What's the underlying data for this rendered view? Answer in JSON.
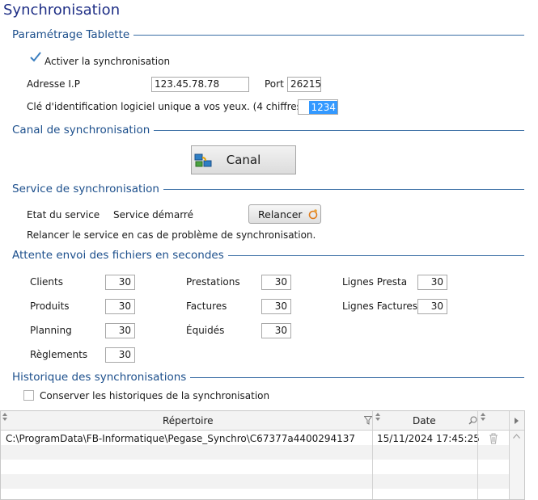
{
  "title": "Synchronisation",
  "sections": {
    "tablette": "Paramétrage Tablette",
    "canal": "Canal de synchronisation",
    "service": "Service de synchronisation",
    "attente": "Attente envoi des fichiers en secondes",
    "historique": "Historique des synchronisations"
  },
  "tablette": {
    "activer_label": "Activer la synchronisation",
    "adresse_label": "Adresse I.P",
    "adresse_value": "123.45.78.78",
    "port_label": "Port",
    "port_value": "26215",
    "cle_label": "Clé d'identification logiciel unique a vos yeux. (4 chiffres)",
    "cle_value": "1234"
  },
  "canal": {
    "button_label": "Canal"
  },
  "service": {
    "etat_label": "Etat du service",
    "etat_value": "Service démarré",
    "relancer_label": "Relancer",
    "hint": "Relancer le service en cas de problème de synchronisation."
  },
  "attente": {
    "clients": {
      "label": "Clients",
      "value": "30"
    },
    "produits": {
      "label": "Produits",
      "value": "30"
    },
    "planning": {
      "label": "Planning",
      "value": "30"
    },
    "reglements": {
      "label": "Règlements",
      "value": "30"
    },
    "prestations": {
      "label": "Prestations",
      "value": "30"
    },
    "factures": {
      "label": "Factures",
      "value": "30"
    },
    "equides": {
      "label": "Équidés",
      "value": "30"
    },
    "lignes_presta": {
      "label": "Lignes Presta",
      "value": "30"
    },
    "lignes_factures": {
      "label": "Lignes Factures",
      "value": "30"
    }
  },
  "historique": {
    "conserver_label": "Conserver les historiques de la synchronisation",
    "columns": {
      "repertoire": "Répertoire",
      "date": "Date"
    },
    "rows": [
      {
        "repertoire": "C:\\ProgramData\\FB-Informatique\\Pegase_Synchro\\C67377a4400294137",
        "date": "15/11/2024 17:45:25"
      }
    ]
  },
  "colors": {
    "title": "#1f2f86",
    "section": "#1c4f8c",
    "selection": "#3399ff"
  }
}
